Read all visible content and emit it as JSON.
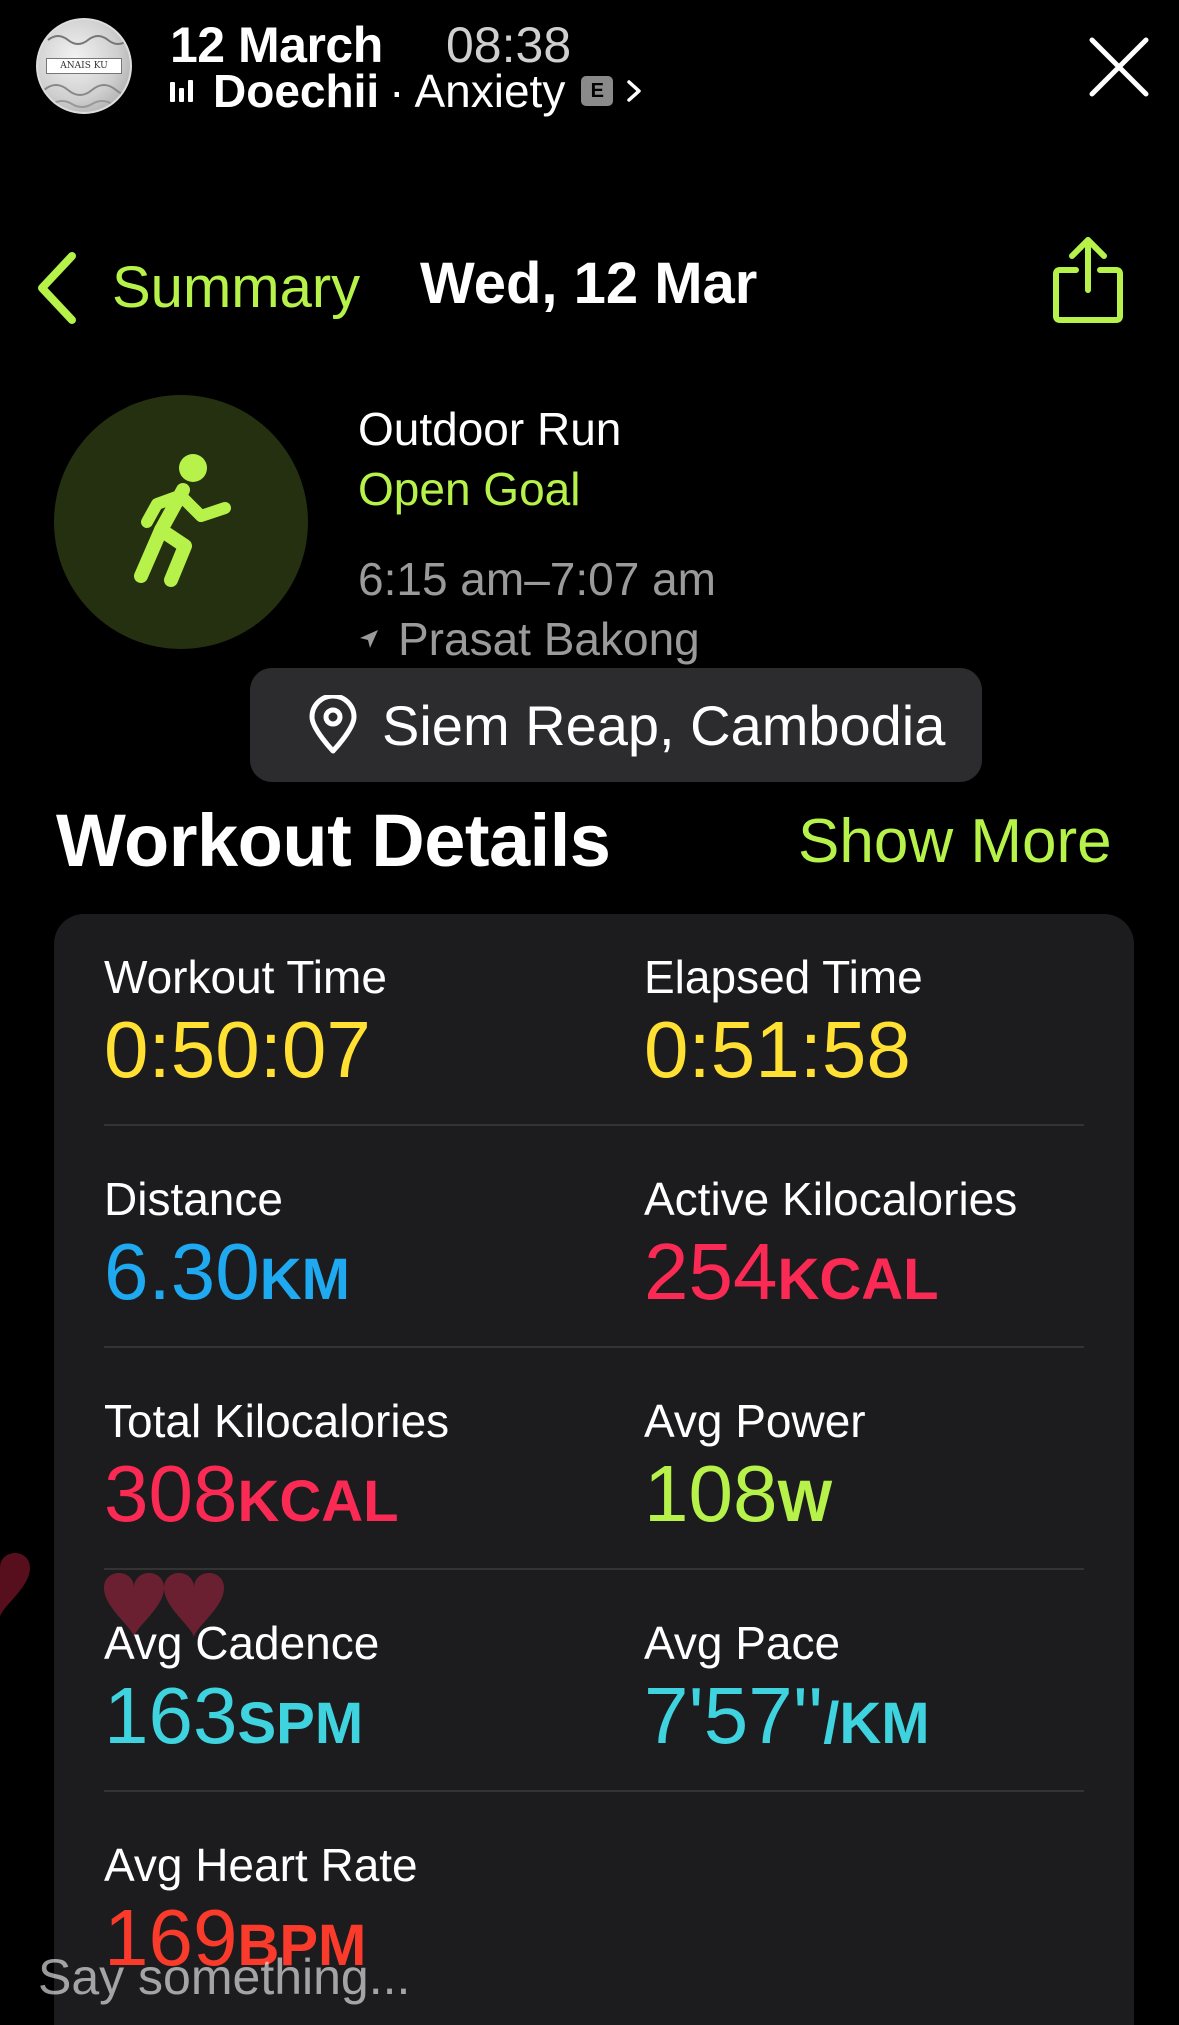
{
  "story": {
    "avatar_text": "ANAIS KU",
    "date": "12 March",
    "time": "08:38",
    "artist": "Doechii",
    "separator": "·",
    "song": "Anxiety",
    "explicit_badge": "E"
  },
  "nav": {
    "back_label": "Summary",
    "title": "Wed, 12 Mar"
  },
  "workout": {
    "type": "Outdoor Run",
    "goal": "Open Goal",
    "time_range": "6:15 am–7:07 am",
    "location": "Prasat Bakong"
  },
  "location_sticker": "Siem Reap, Cambodia",
  "details": {
    "title": "Workout Details",
    "show_more": "Show More",
    "metrics": [
      {
        "label": "Workout Time",
        "value": "0:50:07",
        "unit": "",
        "color": "#ffe033"
      },
      {
        "label": "Elapsed Time",
        "value": "0:51:58",
        "unit": "",
        "color": "#ffe033"
      },
      {
        "label": "Distance",
        "value": "6.30",
        "unit": "KM",
        "color": "#1ea9f0"
      },
      {
        "label": "Active Kilocalories",
        "value": "254",
        "unit": "KCAL",
        "color": "#fa2a55"
      },
      {
        "label": "Total Kilocalories",
        "value": "308",
        "unit": "KCAL",
        "color": "#fa2a55"
      },
      {
        "label": "Avg Power",
        "value": "108",
        "unit": "W",
        "color": "#b6f24a"
      },
      {
        "label": "Avg Cadence",
        "value": "163",
        "unit": "SPM",
        "color": "#3ed3de"
      },
      {
        "label": "Avg Pace",
        "value": "7'57''",
        "unit": "/KM",
        "color": "#3ed3de"
      },
      {
        "label": "Avg Heart Rate",
        "value": "169",
        "unit": "BPM",
        "color": "#fa3a2a"
      }
    ]
  },
  "reply": {
    "placeholder": "Say something..."
  },
  "colors": {
    "accent_green": "#b6f24a",
    "background": "#000000",
    "card": "#1c1c1e"
  }
}
